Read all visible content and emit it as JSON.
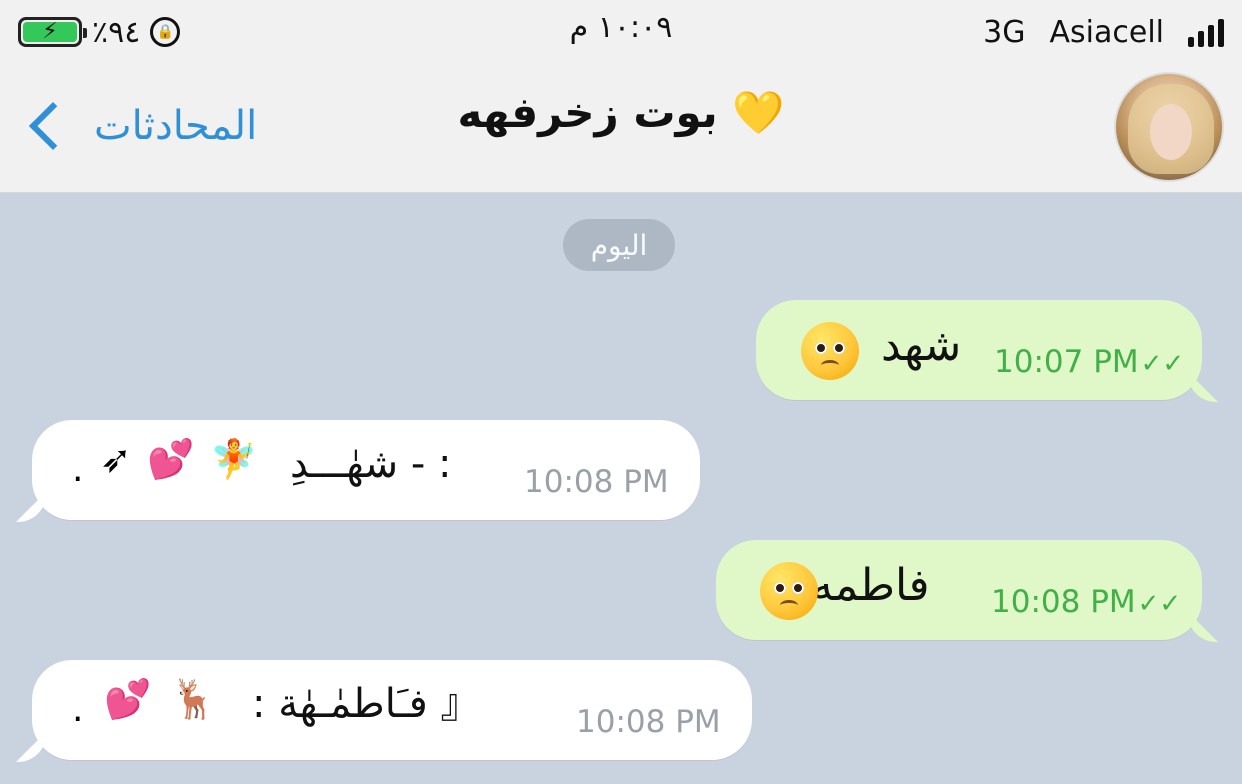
{
  "status_bar": {
    "battery_percent": "٪٩٤",
    "time": "١٠:٠٩ م",
    "network": "3G",
    "carrier": "Asiacell"
  },
  "header": {
    "back_label": "المحادثات",
    "title": "بوت زخرفهه 💛"
  },
  "date_separator": "اليوم",
  "messages": [
    {
      "direction": "out",
      "text": "شهد",
      "time": "10:07 PM",
      "status": "✓✓"
    },
    {
      "direction": "in",
      "text": ": - شهٰـــدِ",
      "time": "10:08 PM",
      "icons": "🧚 💕 ➶ ."
    },
    {
      "direction": "out",
      "text": "فاطمه",
      "time": "10:08 PM",
      "status": "✓✓"
    },
    {
      "direction": "in",
      "text": "『 فـَاطمٰـهٰة :",
      "time": "10:08 PM",
      "icons": "🦌 💕 ."
    }
  ]
}
